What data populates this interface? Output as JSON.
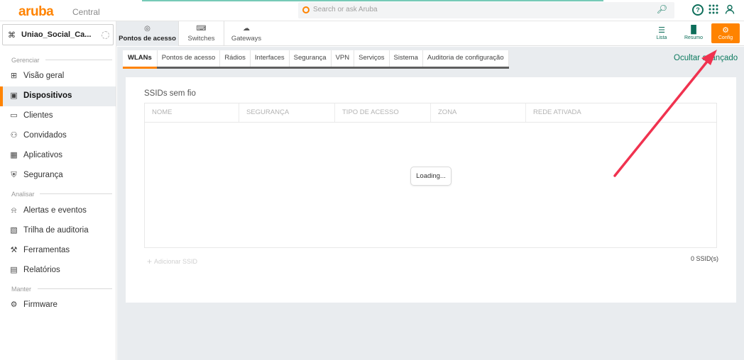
{
  "app": {
    "brand": "aruba",
    "product": "Central"
  },
  "search": {
    "placeholder": "Search or ask Aruba"
  },
  "top_icons": [
    "search-icon",
    "help-icon",
    "apps-grid-icon",
    "user-icon"
  ],
  "site_selector": {
    "name": "Uniao_Social_Ca..."
  },
  "sidebar": {
    "sections": {
      "manage": "Gerenciar",
      "analyze": "Analisar",
      "maintain": "Manter"
    },
    "items": [
      {
        "label": "Visão geral",
        "icon": "overview-icon"
      },
      {
        "label": "Dispositivos",
        "icon": "devices-icon",
        "active": true
      },
      {
        "label": "Clientes",
        "icon": "clients-icon"
      },
      {
        "label": "Convidados",
        "icon": "guests-icon"
      },
      {
        "label": "Aplicativos",
        "icon": "apps-icon"
      },
      {
        "label": "Segurança",
        "icon": "security-icon"
      },
      {
        "label": "Alertas e eventos",
        "icon": "bell-icon"
      },
      {
        "label": "Trilha de auditoria",
        "icon": "audit-icon"
      },
      {
        "label": "Ferramentas",
        "icon": "tools-icon"
      },
      {
        "label": "Relatórios",
        "icon": "reports-icon"
      },
      {
        "label": "Firmware",
        "icon": "firmware-icon"
      }
    ]
  },
  "device_tabs": [
    {
      "label": "Pontos de acesso",
      "icon": "access-point-icon",
      "active": true
    },
    {
      "label": "Switches",
      "icon": "switch-icon"
    },
    {
      "label": "Gateways",
      "icon": "gateway-icon"
    }
  ],
  "view_buttons": [
    {
      "label": "Lista",
      "icon": "list-icon"
    },
    {
      "label": "Resumo",
      "icon": "summary-chart-icon"
    },
    {
      "label": "Config",
      "icon": "config-gear-icon",
      "active": true
    }
  ],
  "sub_tabs": [
    {
      "label": "WLANs",
      "active": true
    },
    {
      "label": "Pontos de acesso"
    },
    {
      "label": "Rádios"
    },
    {
      "label": "Interfaces"
    },
    {
      "label": "Segurança"
    },
    {
      "label": "VPN"
    },
    {
      "label": "Serviços"
    },
    {
      "label": "Sistema"
    },
    {
      "label": "Auditoria de configuração"
    }
  ],
  "hide_advanced": "Ocultar avançado",
  "ssid_card": {
    "title": "SSIDs sem fio",
    "columns": [
      "NOME",
      "SEGURANÇA",
      "TIPO DE ACESSO",
      "ZONA",
      "REDE ATIVADA"
    ],
    "loading_text": "Loading...",
    "add_label": "Adicionar SSID",
    "count_label": "0 SSID(s)"
  },
  "colors": {
    "brand": "#ff8300",
    "accent": "#0d7a5f",
    "annotation": "#f0324f"
  }
}
